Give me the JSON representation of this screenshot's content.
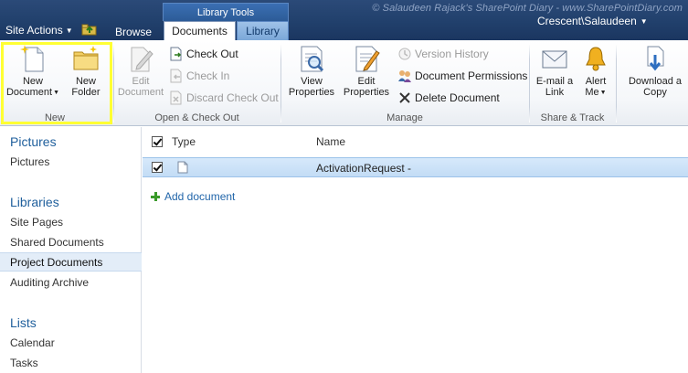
{
  "watermark": "© Salaudeen Rajack's SharePoint Diary - www.SharePointDiary.com",
  "topbar": {
    "site_actions": "Site Actions",
    "browse": "Browse",
    "library_tools": "Library Tools",
    "tabs": [
      {
        "label": "Documents",
        "selected": true
      },
      {
        "label": "Library",
        "selected": false
      }
    ],
    "user": "Crescent\\Salaudeen"
  },
  "ribbon": {
    "groups": [
      {
        "label": "New",
        "buttons": [
          {
            "label_line1": "New",
            "label_line2": "Document",
            "icon": "new-document-icon",
            "dropdown": true
          },
          {
            "label_line1": "New",
            "label_line2": "Folder",
            "icon": "new-folder-icon"
          }
        ]
      },
      {
        "label": "Open & Check Out",
        "buttons": [
          {
            "label_line1": "Edit",
            "label_line2": "Document",
            "icon": "edit-document-icon",
            "disabled": true
          },
          {
            "label": "Check Out",
            "icon": "check-out-icon"
          },
          {
            "label": "Check In",
            "icon": "check-in-icon",
            "disabled": true
          },
          {
            "label": "Discard Check Out",
            "icon": "discard-check-out-icon",
            "disabled": true
          }
        ]
      },
      {
        "label": "Manage",
        "buttons": [
          {
            "label_line1": "View",
            "label_line2": "Properties",
            "icon": "view-properties-icon"
          },
          {
            "label_line1": "Edit",
            "label_line2": "Properties",
            "icon": "edit-properties-icon"
          },
          {
            "label": "Version History",
            "icon": "version-history-icon",
            "disabled": true
          },
          {
            "label": "Document Permissions",
            "icon": "document-permissions-icon"
          },
          {
            "label": "Delete Document",
            "icon": "delete-icon"
          }
        ]
      },
      {
        "label": "Share & Track",
        "buttons": [
          {
            "label_line1": "E-mail a",
            "label_line2": "Link",
            "icon": "email-icon"
          },
          {
            "label_line1": "Alert",
            "label_line2": "Me",
            "icon": "alert-bell-icon",
            "dropdown": true
          }
        ]
      },
      {
        "label": "",
        "buttons": [
          {
            "label_line1": "Download a",
            "label_line2": "Copy",
            "icon": "download-icon"
          }
        ]
      }
    ]
  },
  "leftnav": {
    "sections": [
      {
        "heading": "Pictures",
        "items": [
          "Pictures"
        ]
      },
      {
        "heading": "Libraries",
        "items": [
          "Site Pages",
          "Shared Documents",
          "Project Documents",
          "Auditing Archive"
        ]
      },
      {
        "heading": "Lists",
        "items": [
          "Calendar",
          "Tasks"
        ]
      }
    ],
    "selected": "Project Documents"
  },
  "list": {
    "columns": [
      "Type",
      "Name"
    ],
    "rows": [
      {
        "name": "ActivationRequest -",
        "selected": true
      }
    ],
    "add_document": "Add document"
  },
  "colors": {
    "topbar": "#21406c",
    "highlight": "#ffff33",
    "selected_row": "#c3dcf5",
    "link": "#2266aa",
    "nav_heading": "#1f5f9c"
  }
}
